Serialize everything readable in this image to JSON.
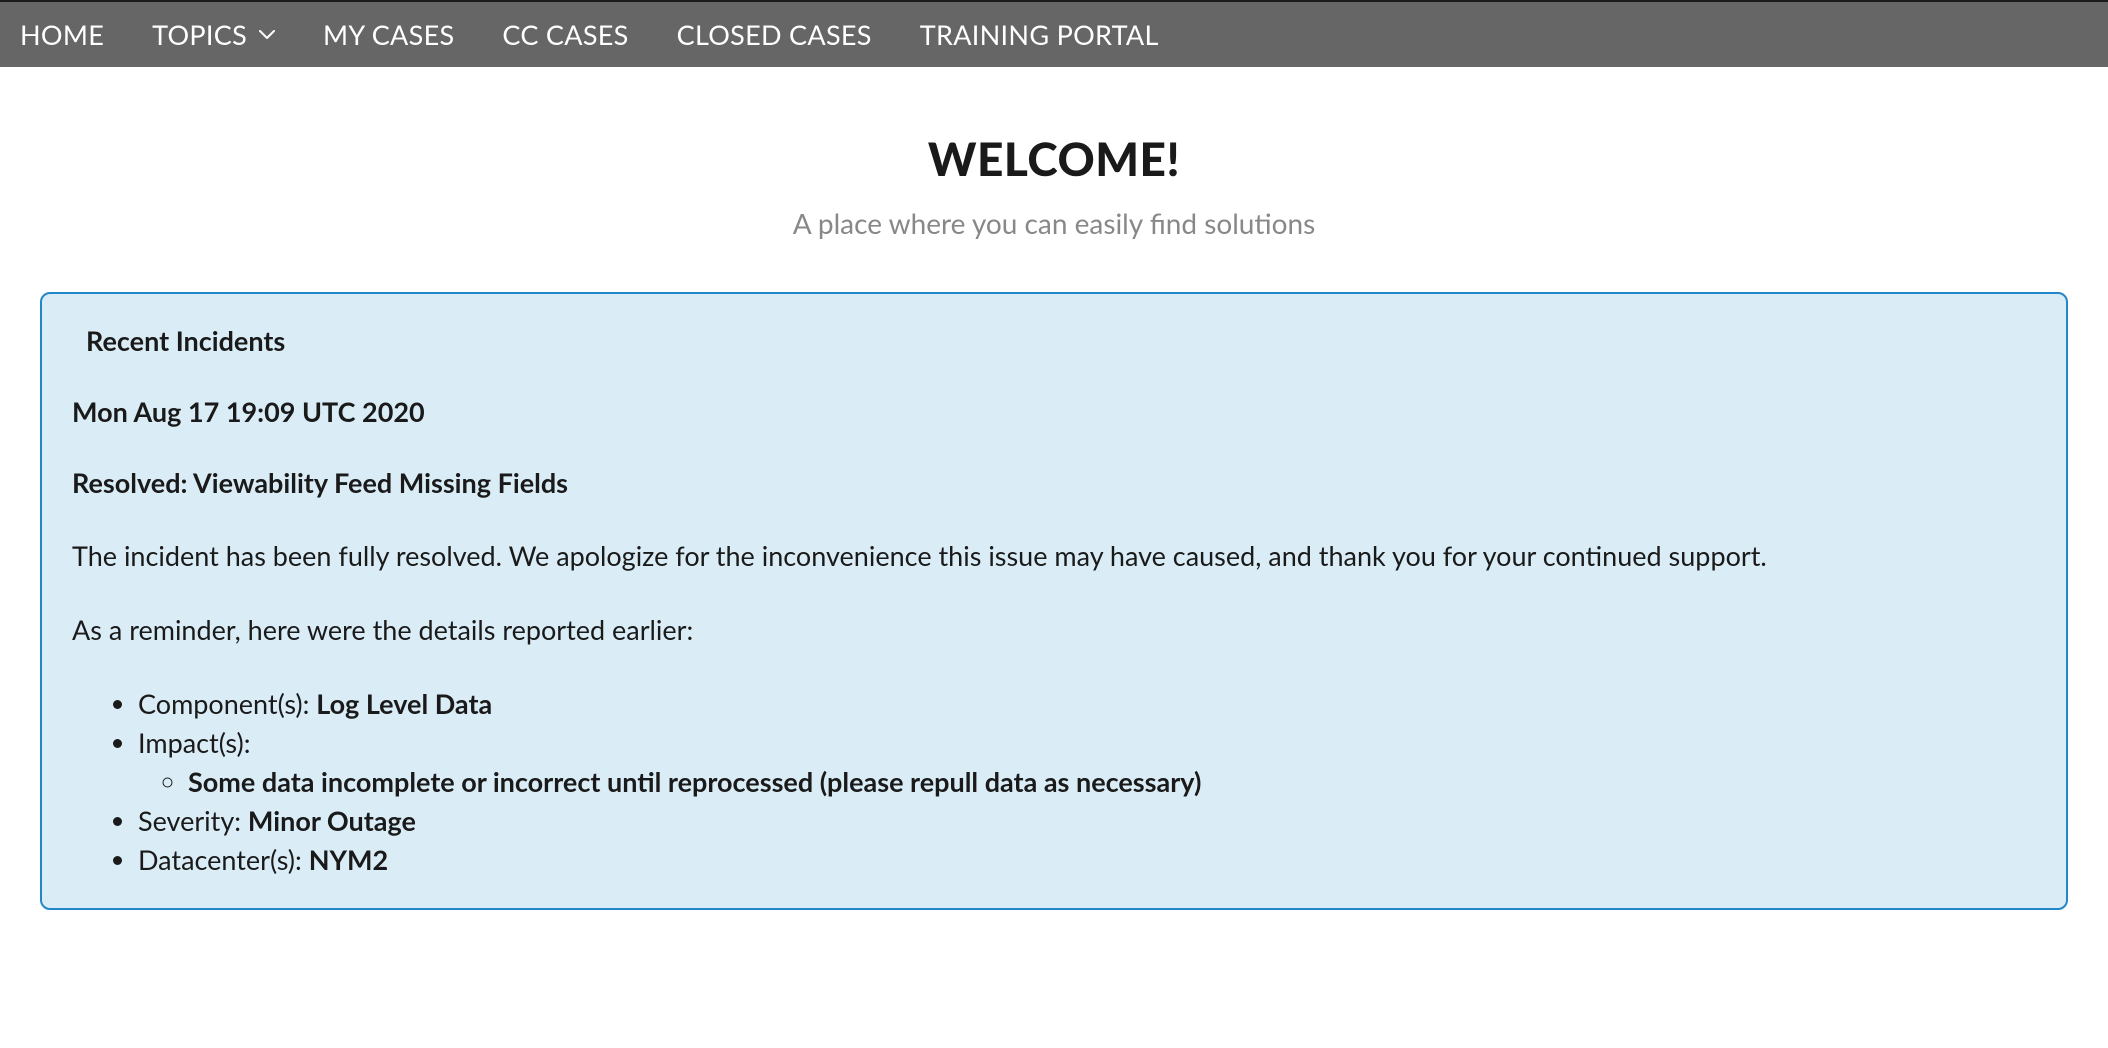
{
  "nav": {
    "items": [
      {
        "label": "HOME",
        "has_dropdown": false
      },
      {
        "label": "TOPICS",
        "has_dropdown": true
      },
      {
        "label": "MY CASES",
        "has_dropdown": false
      },
      {
        "label": "CC CASES",
        "has_dropdown": false
      },
      {
        "label": "CLOSED CASES",
        "has_dropdown": false
      },
      {
        "label": "TRAINING PORTAL",
        "has_dropdown": false
      }
    ]
  },
  "hero": {
    "title": "WELCOME!",
    "subtitle": "A place where you can easily find solutions"
  },
  "panel": {
    "title": "Recent Incidents",
    "incident": {
      "date": "Mon Aug 17 19:09 UTC 2020",
      "title": "Resolved: Viewability Feed Missing Fields",
      "body": "The incident has been fully resolved. We apologize for the inconvenience this issue may have caused, and thank you for your continued support.",
      "reminder": "As a reminder, here were the details reported earlier:",
      "details": {
        "component_label": "Component(s): ",
        "component_value": "Log Level Data",
        "impact_label": "Impact(s):",
        "impact_items": [
          "Some data incomplete or incorrect until reprocessed (please repull data as necessary)"
        ],
        "severity_label": "Severity: ",
        "severity_value": "Minor Outage",
        "datacenter_label": "Datacenter(s): ",
        "datacenter_value": "NYM2"
      }
    }
  }
}
